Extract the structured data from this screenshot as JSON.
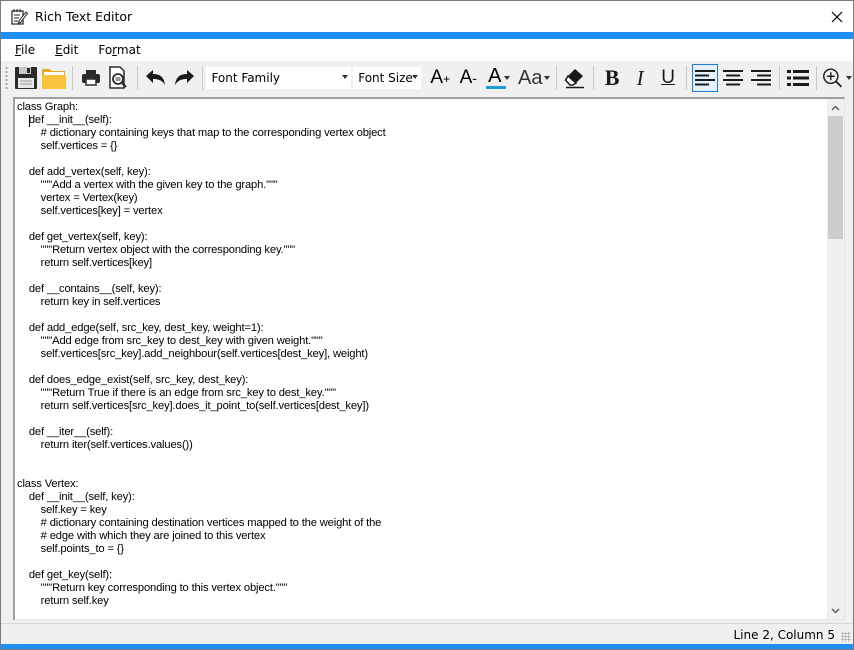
{
  "window": {
    "title": "Rich Text Editor",
    "accent_color": "#1e90f5"
  },
  "menu": {
    "items": [
      {
        "label": "File",
        "mnemonic": "F",
        "rest": "ile"
      },
      {
        "label": "Edit",
        "mnemonic": "E",
        "rest": "dit"
      },
      {
        "label": "Format",
        "pre": "Fo",
        "mnemonic": "r",
        "rest": "mat"
      }
    ]
  },
  "toolbar": {
    "buttons": [
      {
        "name": "save",
        "icon": "floppy-disk-icon"
      },
      {
        "name": "open",
        "icon": "folder-icon"
      },
      {
        "name": "print",
        "icon": "printer-icon"
      },
      {
        "name": "print-preview",
        "icon": "print-preview-icon"
      },
      {
        "name": "undo",
        "icon": "undo-arrow-icon"
      },
      {
        "name": "redo",
        "icon": "redo-arrow-icon"
      },
      {
        "name": "grow-font",
        "icon": "font-grow-icon"
      },
      {
        "name": "shrink-font",
        "icon": "font-shrink-icon"
      },
      {
        "name": "font-color",
        "icon": "font-color-icon"
      },
      {
        "name": "change-case",
        "icon": "change-case-icon"
      },
      {
        "name": "clear-formatting",
        "icon": "eraser-icon"
      },
      {
        "name": "bold",
        "icon": "bold-icon"
      },
      {
        "name": "italic",
        "icon": "italic-icon"
      },
      {
        "name": "underline",
        "icon": "underline-icon"
      },
      {
        "name": "align-left",
        "icon": "align-left-icon",
        "active": true
      },
      {
        "name": "align-center",
        "icon": "align-center-icon"
      },
      {
        "name": "align-right",
        "icon": "align-right-icon"
      },
      {
        "name": "bullet-list",
        "icon": "bullet-list-icon"
      },
      {
        "name": "zoom",
        "icon": "zoom-in-icon"
      }
    ],
    "font_family": {
      "value": "Font Family"
    },
    "font_size": {
      "value": "Font Size"
    },
    "grow_label": "A",
    "grow_suffix": "+",
    "shrink_label": "A",
    "shrink_suffix": "-",
    "color_label": "A",
    "case_label": "Aa",
    "bold_label": "B",
    "italic_label": "I",
    "underline_label": "U",
    "font_color_bar": "#1e9ad6"
  },
  "editor": {
    "lines": [
      "class Graph:",
      "    def __init__(self):",
      "        # dictionary containing keys that map to the corresponding vertex object",
      "        self.vertices = {}",
      "",
      "    def add_vertex(self, key):",
      "        \"\"\"Add a vertex with the given key to the graph.\"\"\"",
      "        vertex = Vertex(key)",
      "        self.vertices[key] = vertex",
      "",
      "    def get_vertex(self, key):",
      "        \"\"\"Return vertex object with the corresponding key.\"\"\"",
      "        return self.vertices[key]",
      "",
      "    def __contains__(self, key):",
      "        return key in self.vertices",
      "",
      "    def add_edge(self, src_key, dest_key, weight=1):",
      "        \"\"\"Add edge from src_key to dest_key with given weight.\"\"\"",
      "        self.vertices[src_key].add_neighbour(self.vertices[dest_key], weight)",
      "",
      "    def does_edge_exist(self, src_key, dest_key):",
      "        \"\"\"Return True if there is an edge from src_key to dest_key.\"\"\"",
      "        return self.vertices[src_key].does_it_point_to(self.vertices[dest_key])",
      "",
      "    def __iter__(self):",
      "        return iter(self.vertices.values())",
      "",
      "",
      "class Vertex:",
      "    def __init__(self, key):",
      "        self.key = key",
      "        # dictionary containing destination vertices mapped to the weight of the",
      "        # edge with which they are joined to this vertex",
      "        self.points_to = {}",
      "",
      "    def get_key(self):",
      "        \"\"\"Return key corresponding to this vertex object.\"\"\"",
      "        return self.key"
    ],
    "scroll_position": 0
  },
  "status": {
    "cursor_position": "Line 2, Column 5"
  }
}
